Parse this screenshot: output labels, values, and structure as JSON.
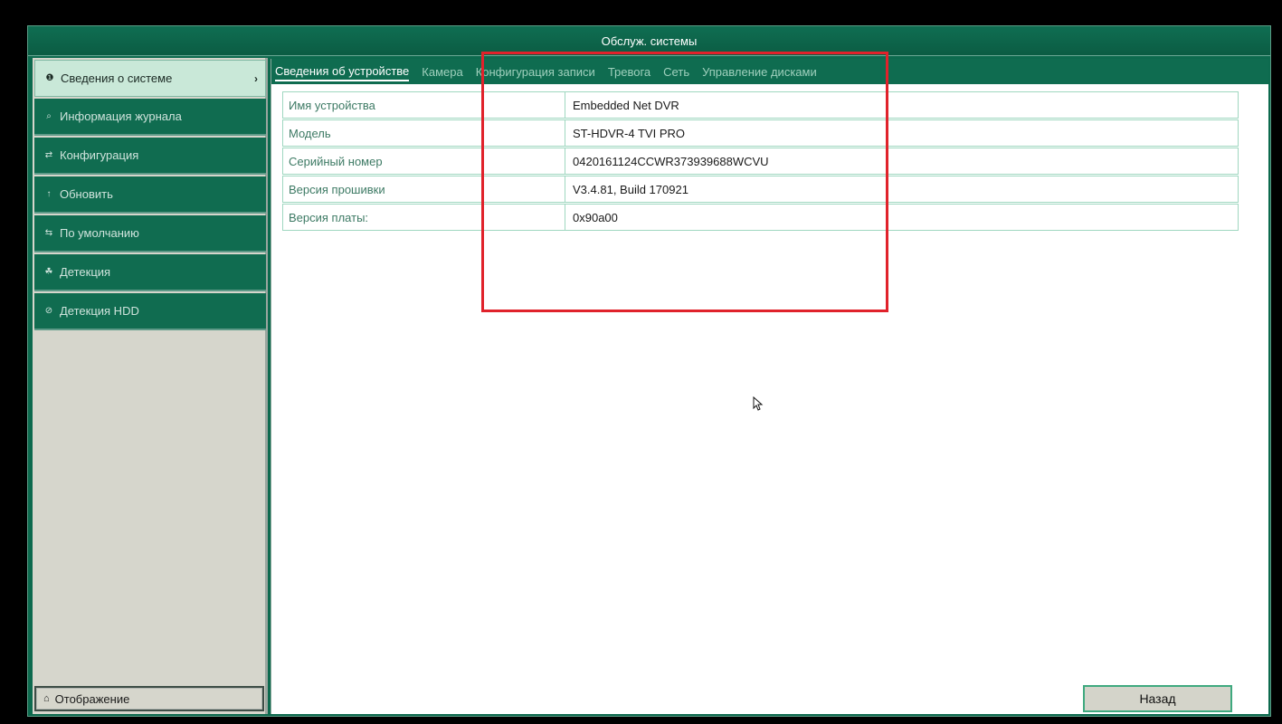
{
  "window": {
    "title": "Обслуж. системы"
  },
  "sidebar": {
    "items": [
      {
        "label": "Сведения о системе",
        "icon": "info-icon",
        "glyph": "❶",
        "active": true,
        "chevron": "›"
      },
      {
        "label": "Информация журнала",
        "icon": "search-log-icon",
        "glyph": "⌕",
        "active": false
      },
      {
        "label": "Конфигурация",
        "icon": "config-icon",
        "glyph": "⇄",
        "active": false
      },
      {
        "label": "Обновить",
        "icon": "upgrade-icon",
        "glyph": "↑",
        "active": false
      },
      {
        "label": "По умолчанию",
        "icon": "default-icon",
        "glyph": "⇆",
        "active": false
      },
      {
        "label": "Детекция",
        "icon": "detection-icon",
        "glyph": "☘",
        "active": false
      },
      {
        "label": "Детекция HDD",
        "icon": "hdd-detection-icon",
        "glyph": "⊘",
        "active": false
      }
    ],
    "bottom_button": {
      "label": "Отображение",
      "icon": "home-icon",
      "glyph": "⌂"
    }
  },
  "tabs": [
    {
      "label": "Сведения об устройстве",
      "active": true
    },
    {
      "label": "Камера",
      "active": false
    },
    {
      "label": "Конфигурация записи",
      "active": false
    },
    {
      "label": "Тревога",
      "active": false
    },
    {
      "label": "Сеть",
      "active": false
    },
    {
      "label": "Управление дисками",
      "active": false
    }
  ],
  "device_info": {
    "rows": [
      {
        "label": "Имя устройства",
        "value": "Embedded Net DVR"
      },
      {
        "label": "Модель",
        "value": "ST-HDVR-4 TVI PRO"
      },
      {
        "label": "Серийный номер",
        "value": "0420161124CCWR373939688WCVU"
      },
      {
        "label": "Версия прошивки",
        "value": "V3.4.81, Build 170921"
      },
      {
        "label": "Версия платы:",
        "value": "0x90a00"
      }
    ]
  },
  "footer": {
    "back_label": "Назад"
  },
  "colors": {
    "accent": "#0d6a4e",
    "highlight": "#e0222b",
    "active_item": "#c9e8d8"
  }
}
